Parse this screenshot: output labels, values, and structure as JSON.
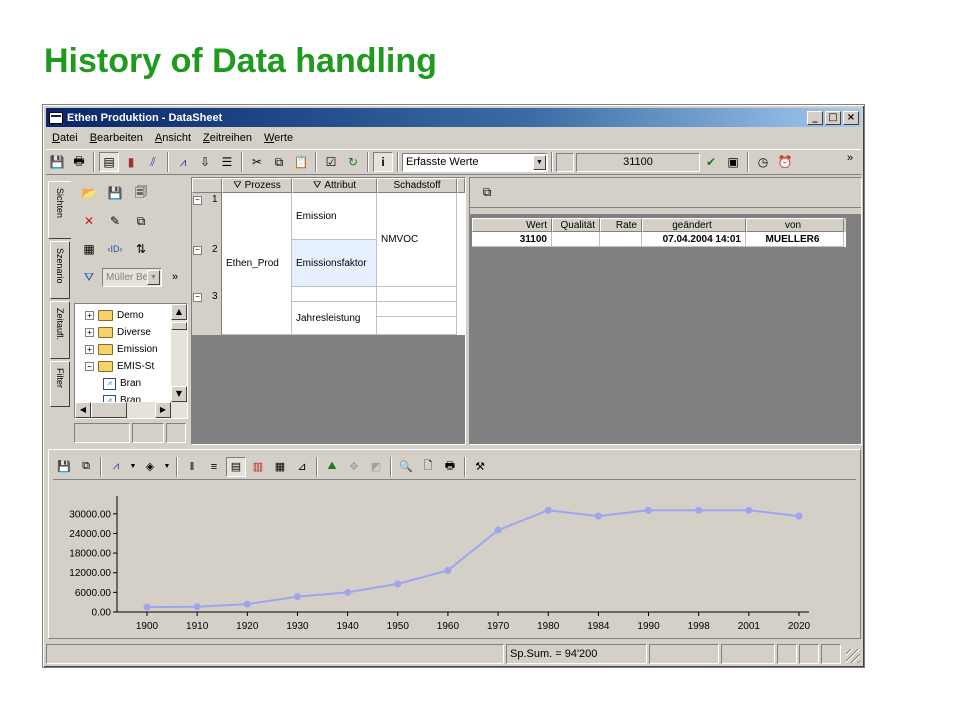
{
  "slide": {
    "title": "History of Data handling"
  },
  "window": {
    "title": "Ethen Produktion - DataSheet",
    "buttons": {
      "minimize": "_",
      "maximize": "□",
      "close": "×"
    }
  },
  "menu": [
    "Datei",
    "Bearbeiten",
    "Ansicht",
    "Zeitreihen",
    "Werte"
  ],
  "toolbar": {
    "combo_value": "Erfasste Werte",
    "value_field": "31100",
    "overflow": "»"
  },
  "left_panel": {
    "tabs": [
      "Sichten",
      "Szenario",
      "Zeitaufl.",
      "Filter"
    ],
    "filter_combo": "Müller Be",
    "overflow": "»",
    "tree": [
      {
        "label": "Demo",
        "expander": "+",
        "type": "folder",
        "indent": 0
      },
      {
        "label": "Diverse",
        "expander": "+",
        "type": "folder",
        "indent": 0
      },
      {
        "label": "Emission",
        "expander": "+",
        "type": "folder",
        "indent": 0
      },
      {
        "label": "EMIS-St",
        "expander": "−",
        "type": "folder",
        "indent": 0
      },
      {
        "label": "Bran",
        "expander": "",
        "type": "chart",
        "indent": 1
      },
      {
        "label": "Bran",
        "expander": "",
        "type": "chart",
        "indent": 1
      }
    ]
  },
  "grid": {
    "headers": {
      "prozess": "Prozess",
      "attribut": "Attribut",
      "schadstoff": "Schadstoff"
    },
    "row_numbers": [
      "1",
      "2",
      "3"
    ],
    "row_expanders": [
      "−",
      "−",
      "−"
    ],
    "prozess": "Ethen_Prod",
    "attributes": [
      "Emission",
      "Emissionsfaktor",
      "Jahresleistung"
    ],
    "schadstoff": "NMVOC"
  },
  "values_table": {
    "headers": [
      "Wert",
      "Qualität",
      "Rate",
      "geändert",
      "von"
    ],
    "row": {
      "wert": "31100",
      "qualitaet": "",
      "rate": "",
      "geaendert": "07.04.2004  14:01",
      "von": "MUELLER6"
    }
  },
  "statusbar": {
    "sum": "Sp.Sum. = 94'200"
  },
  "chart_data": {
    "type": "line",
    "categories": [
      "1900",
      "1910",
      "1920",
      "1930",
      "1940",
      "1950",
      "1960",
      "1970",
      "1980",
      "1984",
      "1990",
      "1998",
      "2001",
      "2020"
    ],
    "series": [
      {
        "values": [
          1500,
          1600,
          2400,
          4700,
          6000,
          8600,
          12700,
          25000,
          31100,
          29300,
          31100,
          31100,
          31100,
          29300
        ]
      }
    ],
    "y_ticks": [
      "0.00",
      "6000.00",
      "12000.00",
      "18000.00",
      "24000.00",
      "30000.00"
    ],
    "ylim": [
      0,
      33000
    ],
    "title": "",
    "xlabel": "",
    "ylabel": "",
    "line_color": "#a0a4f0",
    "grid": false
  }
}
